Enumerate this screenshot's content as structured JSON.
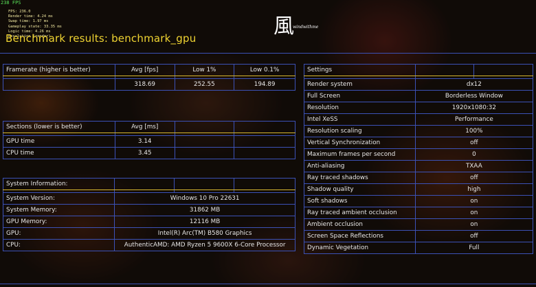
{
  "overlay": {
    "fps_corner": "238 FPS",
    "stats": "FPS: 236.0\nRender time: 4.24 ms\nSwap time: 1.97 ms\nGameplay state: 33.35 ms\nLogic time: 4.26 ms\nResolution (render)"
  },
  "header": {
    "title": "Benchmark results: benchmark_gpu",
    "logo_glyph": "風",
    "logo_text": "windwithme"
  },
  "framerate": {
    "header": [
      "Framerate (higher is better)",
      "Avg [fps]",
      "Low 1%",
      "Low 0.1%"
    ],
    "row": [
      "",
      "318.69",
      "252.55",
      "194.89"
    ]
  },
  "sections": {
    "header": [
      "Sections (lower is better)",
      "Avg [ms]",
      "",
      ""
    ],
    "rows": [
      [
        "GPU time",
        "3.14",
        "",
        ""
      ],
      [
        "CPU time",
        "3.45",
        "",
        ""
      ]
    ]
  },
  "system": {
    "header": "System Information:",
    "rows": [
      [
        "System Version:",
        "Windows 10 Pro 22631"
      ],
      [
        "System Memory:",
        "31862 MB"
      ],
      [
        "GPU Memory:",
        "12116 MB"
      ],
      [
        "GPU:",
        "Intel(R) Arc(TM) B580 Graphics"
      ],
      [
        "CPU:",
        "AuthenticAMD: AMD Ryzen 5 9600X 6-Core Processor"
      ]
    ]
  },
  "settings": {
    "header": "Settings",
    "rows": [
      [
        "Render system",
        "dx12"
      ],
      [
        "Full Screen",
        "Borderless Window"
      ],
      [
        "Resolution",
        "1920x1080:32"
      ],
      [
        "Intel XeSS",
        "Performance"
      ],
      [
        "Resolution scaling",
        "100%"
      ],
      [
        "Vertical Synchronization",
        "off"
      ],
      [
        "Maximum frames per second",
        "0"
      ],
      [
        "Anti-aliasing",
        "TXAA"
      ],
      [
        "Ray traced shadows",
        "off"
      ],
      [
        "Shadow quality",
        "high"
      ],
      [
        "Soft shadows",
        "on"
      ],
      [
        "Ray traced ambient occlusion",
        "on"
      ],
      [
        "Ambient occlusion",
        "on"
      ],
      [
        "Screen Space Reflections",
        "off"
      ],
      [
        "Dynamic Vegetation",
        "Full"
      ]
    ]
  }
}
